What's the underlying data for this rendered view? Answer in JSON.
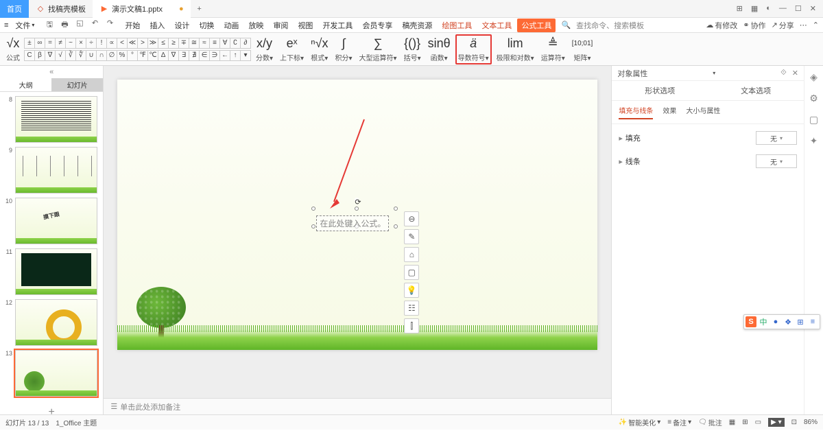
{
  "titlebar": {
    "tabs": [
      {
        "label": "首页",
        "icon": "home"
      },
      {
        "label": "找稿壳模板",
        "icon": "doc"
      },
      {
        "label": "演示文稿1.pptx",
        "icon": "ppt"
      }
    ]
  },
  "menu": {
    "file": "文件",
    "tabs": [
      "开始",
      "插入",
      "设计",
      "切换",
      "动画",
      "放映",
      "审阅",
      "视图",
      "开发工具",
      "会员专享",
      "稿壳资源"
    ],
    "ctx_tabs": [
      "绘图工具",
      "文本工具",
      "公式工具"
    ],
    "active_ctx": "公式工具",
    "search_placeholder": "查找命令、搜索模板",
    "right": [
      "有修改",
      "协作",
      "分享"
    ]
  },
  "ribbon": {
    "groups": [
      "公式",
      "分数",
      "上下标",
      "根式",
      "积分",
      "大型运算符",
      "括号",
      "函数",
      "导数符号",
      "极限和对数",
      "运算符",
      "矩阵"
    ],
    "highlighted": "导数符号",
    "icons": [
      "√x",
      "x/y",
      "eˣ",
      "ⁿ√x",
      "∫",
      "∑",
      "{()}",
      "sinθ",
      "ä",
      "lim",
      "≜",
      "[10;01]"
    ]
  },
  "thumb_tabs": [
    "大纲",
    "幻灯片"
  ],
  "slides": [
    8,
    9,
    10,
    11,
    12,
    13
  ],
  "current_slide": 13,
  "slide_content": {
    "equation_placeholder": "在此处键入公式。"
  },
  "notes_placeholder": "单击此处添加备注",
  "rpanel": {
    "title": "对象属性",
    "tabs": [
      "形状选项",
      "文本选项"
    ],
    "subtabs": [
      "填充与线条",
      "效果",
      "大小与属性"
    ],
    "rows": [
      {
        "label": "填充",
        "value": "无"
      },
      {
        "label": "线条",
        "value": "无"
      }
    ]
  },
  "status": {
    "slide": "幻灯片 13 / 13",
    "theme": "1_Office 主题",
    "beautify": "智能美化",
    "remark": "备注",
    "approve": "批注",
    "zoom": "86%"
  },
  "ime": {
    "chars": [
      "S",
      "中",
      "●",
      "❖",
      "⊞",
      "≡"
    ]
  }
}
